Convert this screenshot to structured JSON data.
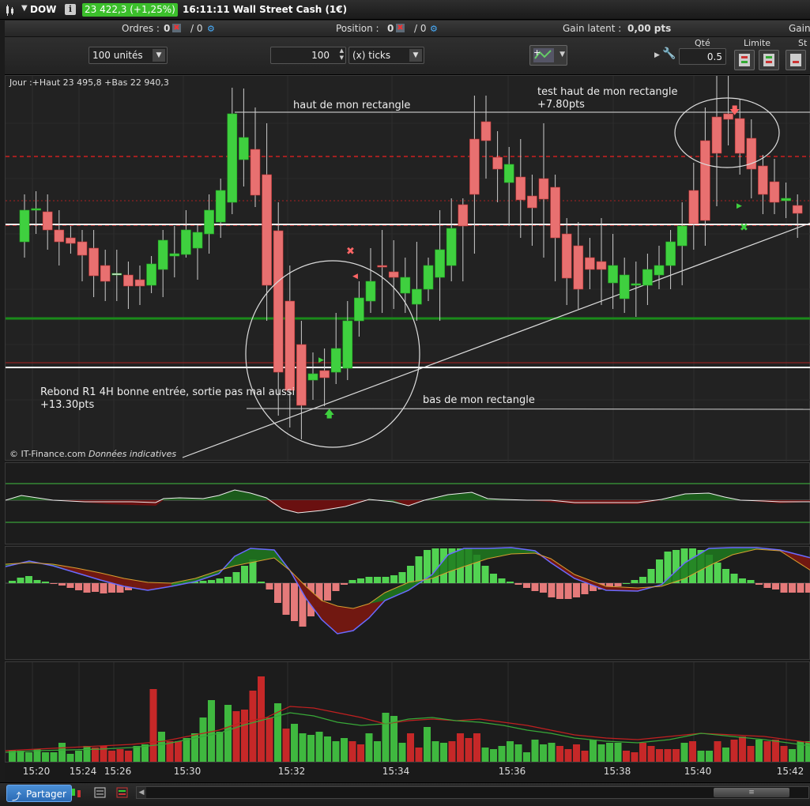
{
  "titlebar": {
    "symbol": "DOW",
    "info_icon": "i",
    "price_change": "23 422,3 (+1,25%)",
    "title": "16:11:11 Wall Street Cash (1€)",
    "menu_arrow": "▼"
  },
  "infobar": {
    "orders_label": "Ordres :",
    "orders_value": "0",
    "orders_sep": "/ 0",
    "position_label": "Position :",
    "position_value": "0",
    "position_sep": "/ 0",
    "gain_label": "Gain latent :",
    "gain_value": "0,00 pts",
    "gain_cut_label": "Gain"
  },
  "toolbar": {
    "units_select": "100 unités",
    "ticks_value": "100",
    "ticks_select": "(x) ticks",
    "qty_label": "Qté",
    "qty_value": "0.5",
    "limit_label": "Limite",
    "stop_label": "St"
  },
  "chart": {
    "header": "Jour :+Haut 23 495,8 +Bas 22 940,3",
    "copyright": "© IT-Finance.com",
    "copyright_note": "Données indicatives",
    "annotations": {
      "top_rect": "haut de mon rectangle",
      "test_top_line1": "test haut de mon rectangle",
      "test_top_line2": "+7.80pts",
      "rebound_line1": "Rebond R1 4H bonne entrée, sortie pas mal aussi",
      "rebound_line2": "+13.30pts",
      "bottom_rect": "bas de mon rectangle"
    },
    "colors": {
      "up": "#3fd03f",
      "down": "#e05050",
      "support": "#1a8a1a",
      "resistance": "#cc2020"
    }
  },
  "time_axis": [
    "15:20",
    "15:24",
    "15:26",
    "15:30",
    "15:32",
    "15:34",
    "15:36",
    "15:38",
    "15:40",
    "15:42"
  ],
  "bottombar": {
    "share_label": "Partager",
    "share_icon": "share-icon"
  },
  "chart_data": {
    "type": "candlestick",
    "title": "Jour :+Haut 23 495,8 +Bas 22 940,3",
    "x_ticks": [
      "15:20",
      "15:24",
      "15:26",
      "15:30",
      "15:32",
      "15:34",
      "15:36",
      "15:38",
      "15:40",
      "15:42"
    ],
    "candles_direction": [
      "up",
      "up",
      "down",
      "down",
      "down",
      "down",
      "down",
      "down",
      "flat",
      "down",
      "down",
      "up",
      "up",
      "up",
      "up",
      "up",
      "up",
      "up",
      "up",
      "up",
      "down",
      "down",
      "down",
      "down",
      "down",
      "up",
      "down",
      "up",
      "up",
      "up",
      "up",
      "down",
      "down",
      "up",
      "up",
      "up",
      "up",
      "up",
      "down",
      "down",
      "down",
      "down",
      "up",
      "down",
      "down",
      "down",
      "down",
      "down",
      "down",
      "down",
      "down",
      "up",
      "up",
      "up",
      "up",
      "up",
      "up",
      "up",
      "down",
      "down",
      "down",
      "down",
      "down",
      "down",
      "down",
      "down",
      "up",
      "down"
    ],
    "volume_direction": [
      "up",
      "up",
      "up",
      "up",
      "up",
      "up",
      "up",
      "up",
      "up",
      "up",
      "down",
      "down",
      "down",
      "down",
      "down",
      "up",
      "up",
      "down",
      "up",
      "down",
      "down",
      "up",
      "up",
      "up",
      "up",
      "up",
      "up",
      "down",
      "down",
      "down",
      "down",
      "down",
      "up",
      "down",
      "up",
      "up",
      "up",
      "up",
      "up",
      "up",
      "up",
      "down",
      "down",
      "up",
      "up",
      "up",
      "up",
      "up",
      "down",
      "down",
      "up",
      "up",
      "up",
      "down",
      "down",
      "down",
      "down",
      "up",
      "up",
      "up",
      "up",
      "up",
      "up",
      "up",
      "up",
      "up",
      "down",
      "down",
      "down",
      "down",
      "up",
      "up",
      "up",
      "up",
      "down",
      "down",
      "down",
      "down",
      "down",
      "down",
      "down",
      "up",
      "down",
      "up",
      "up",
      "down",
      "up",
      "down",
      "down",
      "down",
      "up",
      "down",
      "down",
      "down",
      "up",
      "up",
      "up"
    ]
  }
}
